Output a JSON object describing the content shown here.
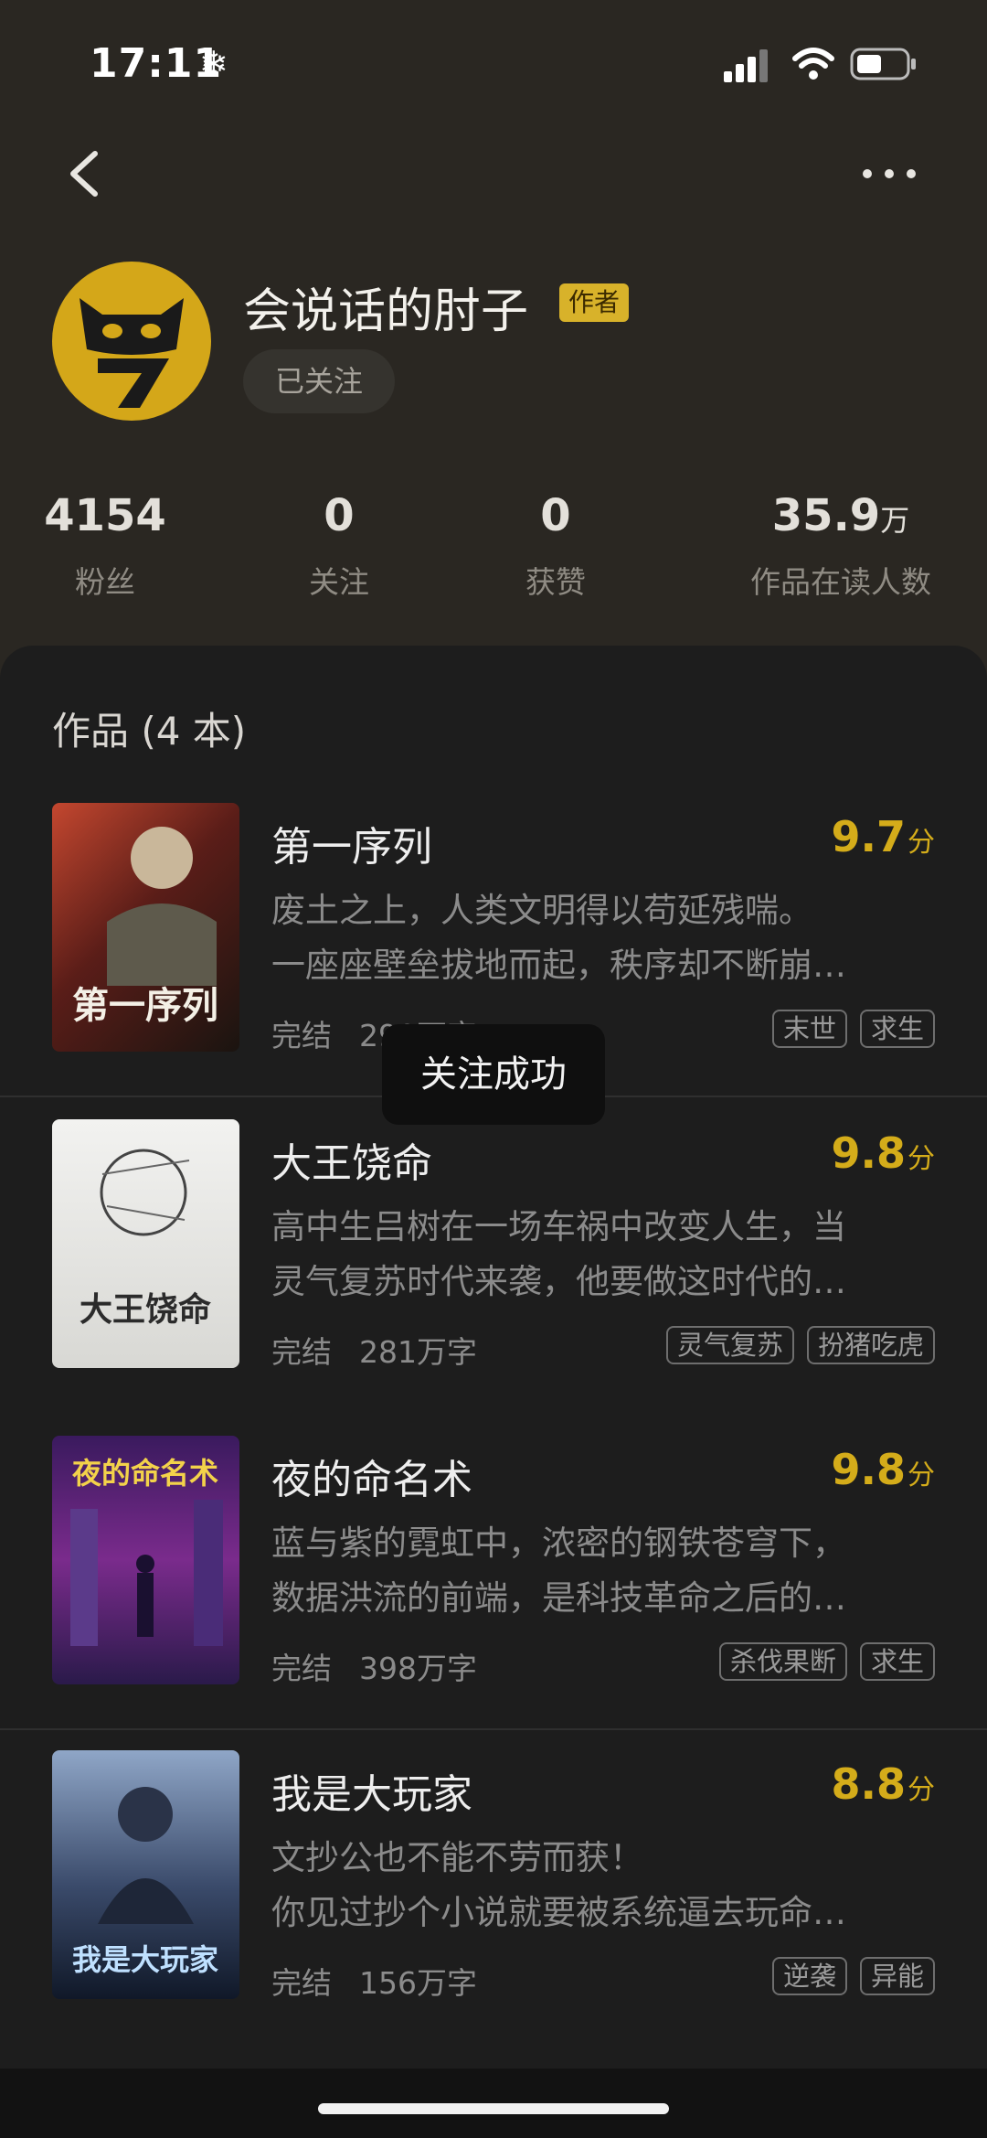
{
  "status": {
    "time": "17:11"
  },
  "author": {
    "name": "会说话的肘子",
    "badge": "作者",
    "follow_label": "已关注"
  },
  "stats": [
    {
      "value": "4154",
      "unit": "",
      "label": "粉丝"
    },
    {
      "value": "0",
      "unit": "",
      "label": "关注"
    },
    {
      "value": "0",
      "unit": "",
      "label": "获赞"
    },
    {
      "value": "35.9",
      "unit": "万",
      "label": "作品在读人数"
    }
  ],
  "works": {
    "title": "作品 (4 本)",
    "books": [
      {
        "title": "第一序列",
        "score": "9.7",
        "score_unit": "分",
        "desc_line1": "废土之上，人类文明得以苟延残喘。",
        "desc_line2": "一座座壁垒拔地而起，秩序却不断崩…",
        "status": "完结",
        "words": "290万字",
        "tags": [
          "末世",
          "求生"
        ],
        "cover_text": "第一序列"
      },
      {
        "title": "大王饶命",
        "score": "9.8",
        "score_unit": "分",
        "desc_line1": "高中生吕树在一场车祸中改变人生，当",
        "desc_line2": "灵气复苏时代来袭，他要做这时代的…",
        "status": "完结",
        "words": "281万字",
        "tags": [
          "灵气复苏",
          "扮猪吃虎"
        ],
        "cover_text": "大王饶命"
      },
      {
        "title": "夜的命名术",
        "score": "9.8",
        "score_unit": "分",
        "desc_line1": "蓝与紫的霓虹中，浓密的钢铁苍穹下，",
        "desc_line2": "数据洪流的前端，是科技革命之后的…",
        "status": "完结",
        "words": "398万字",
        "tags": [
          "杀伐果断",
          "求生"
        ],
        "cover_text": "夜的命名术"
      },
      {
        "title": "我是大玩家",
        "score": "8.8",
        "score_unit": "分",
        "desc_line1": "文抄公也不能不劳而获！",
        "desc_line2": "你见过抄个小说就要被系统逼去玩命…",
        "status": "完结",
        "words": "156万字",
        "tags": [
          "逆袭",
          "异能"
        ],
        "cover_text": "我是大玩家"
      }
    ]
  },
  "toast": "关注成功"
}
